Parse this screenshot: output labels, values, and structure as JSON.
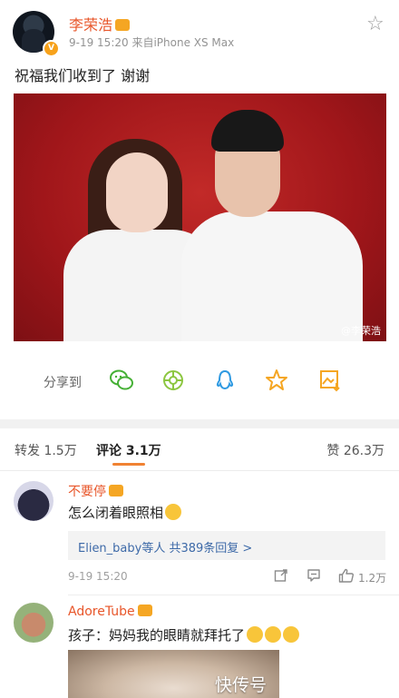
{
  "post": {
    "author": "李荣浩",
    "verified_badge": "V",
    "meta": "9-19 15:20  来自iPhone XS Max",
    "text": "祝福我们收到了 谢谢",
    "image_watermark": "@李荣浩"
  },
  "share": {
    "label": "分享到",
    "targets": [
      "wechat-icon",
      "moments-icon",
      "qq-icon",
      "favorite-star-icon",
      "save-image-icon"
    ]
  },
  "tabs": {
    "repost": "转发 1.5万",
    "comments": "评论 3.1万",
    "likes": "赞 26.3万"
  },
  "comments": [
    {
      "name": "不要停",
      "text": "怎么闭着眼照相",
      "reply_summary": "Elien_baby等人 共389条回复 >",
      "time": "9-19 15:20",
      "likes": "1.2万"
    },
    {
      "name": "AdoreTube",
      "text": "孩子：妈妈我的眼睛就拜托了"
    }
  ],
  "site_watermark": "快传号",
  "colors": {
    "username": "#e8562a",
    "link": "#3e6aa8",
    "tab_underline": "#f08232",
    "photo_background": "#aa1a1a"
  }
}
